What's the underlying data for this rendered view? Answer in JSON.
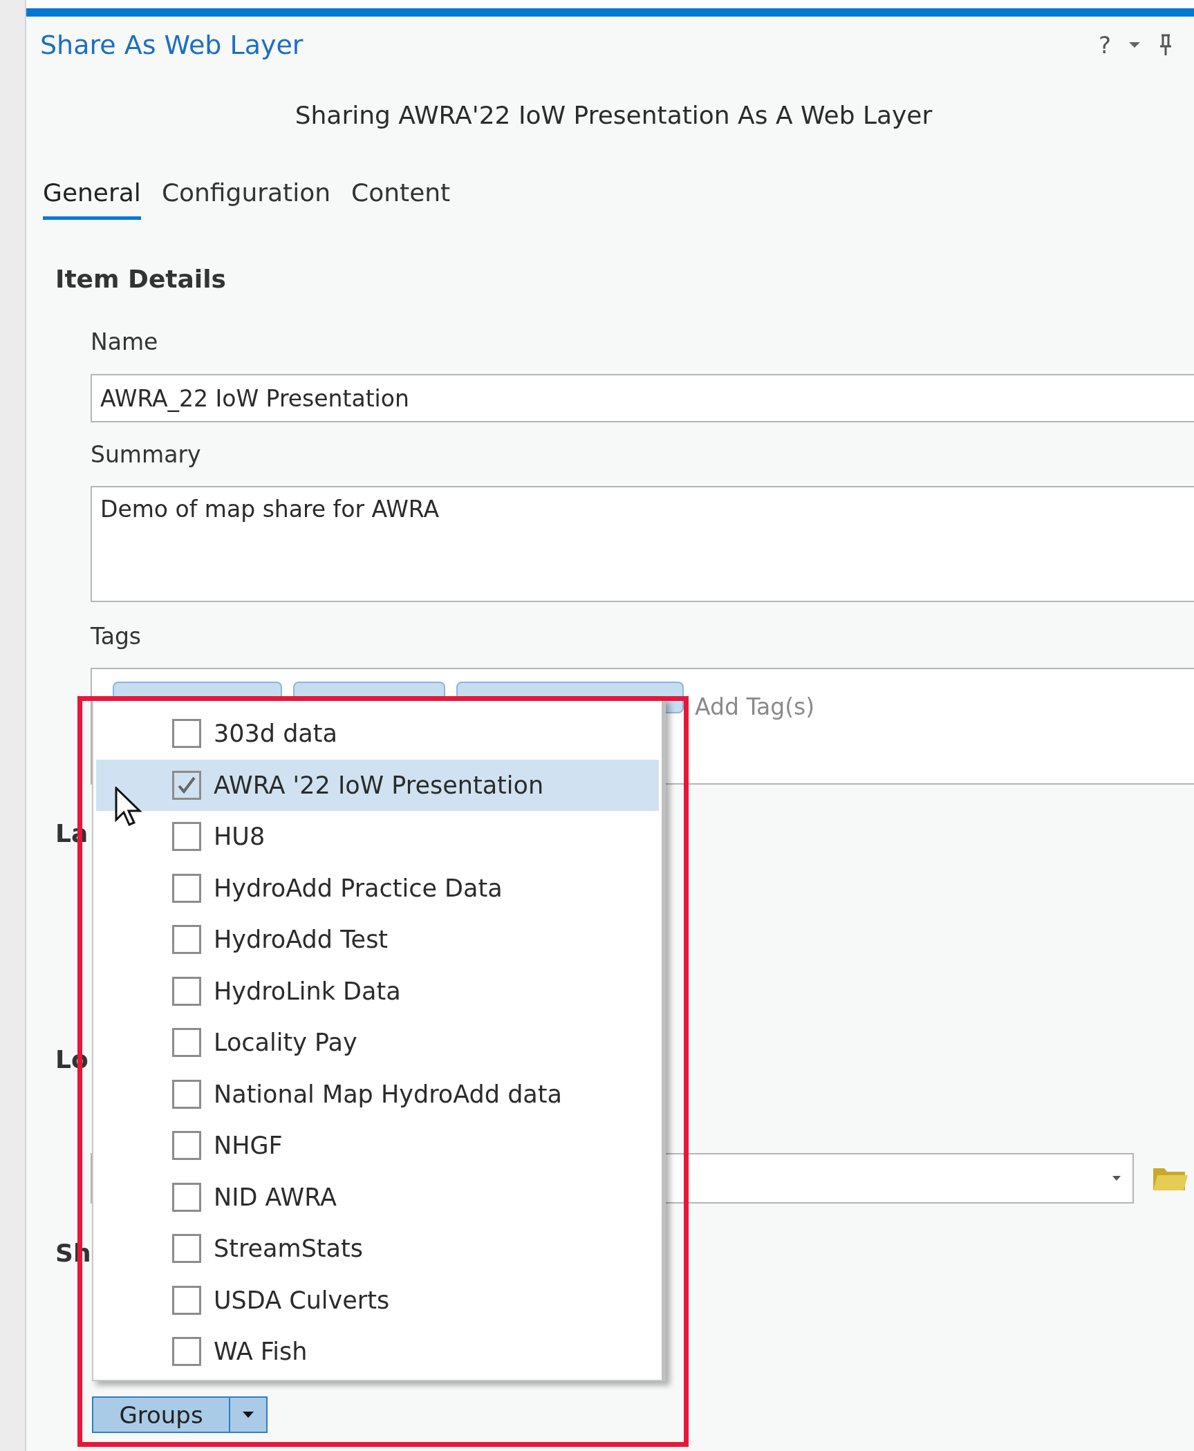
{
  "window": {
    "title": "Share As Web Layer",
    "help": "?"
  },
  "heading": "Sharing AWRA'22 IoW Presentation As A Web Layer",
  "tabs": [
    {
      "label": "General",
      "selected": true
    },
    {
      "label": "Configuration",
      "selected": false
    },
    {
      "label": "Content",
      "selected": false
    }
  ],
  "item_details": {
    "title": "Item Details",
    "name": {
      "label": "Name",
      "value": "AWRA_22 IoW Presentation"
    },
    "summary": {
      "label": "Summary",
      "value": "Demo of map share for AWRA"
    },
    "tags": {
      "label": "Tags",
      "chips": [
        {
          "kind": "tag"
        },
        {
          "kind": "tag"
        },
        {
          "kind": "tag"
        }
      ],
      "placeholder": "Add Tag(s)"
    }
  },
  "partial_headings": [
    "La",
    "Lo",
    "Sh"
  ],
  "groups": {
    "button": "Groups",
    "items": [
      {
        "label": "303d data",
        "checked": false,
        "selected": false
      },
      {
        "label": "AWRA '22 IoW Presentation",
        "checked": true,
        "selected": true
      },
      {
        "label": "HU8",
        "checked": false,
        "selected": false
      },
      {
        "label": "HydroAdd Practice Data",
        "checked": false,
        "selected": false
      },
      {
        "label": "HydroAdd Test",
        "checked": false,
        "selected": false
      },
      {
        "label": "HydroLink Data",
        "checked": false,
        "selected": false
      },
      {
        "label": "Locality Pay",
        "checked": false,
        "selected": false
      },
      {
        "label": "National Map HydroAdd data",
        "checked": false,
        "selected": false
      },
      {
        "label": "NHGF",
        "checked": false,
        "selected": false
      },
      {
        "label": "NID AWRA",
        "checked": false,
        "selected": false
      },
      {
        "label": "StreamStats",
        "checked": false,
        "selected": false
      },
      {
        "label": "USDA Culverts",
        "checked": false,
        "selected": false
      },
      {
        "label": "WA Fish",
        "checked": false,
        "selected": false
      }
    ]
  }
}
